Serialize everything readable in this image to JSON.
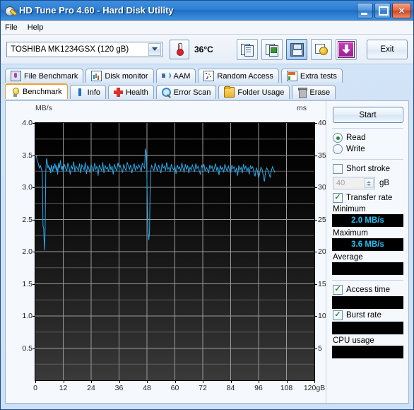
{
  "window": {
    "title": "HD Tune Pro 4.60 - Hard Disk Utility",
    "icon": "hard-disk-icon",
    "minimize_label": "",
    "maximize_label": "",
    "close_label": "✕"
  },
  "menu": {
    "items": [
      "File",
      "Help"
    ]
  },
  "toolbar": {
    "drive_selected": "TOSHIBA MK1234GSX (120 gB)",
    "temperature": "36°C",
    "thermometer_icon": "thermometer-icon",
    "buttons": [
      {
        "name": "copy-text-button",
        "icon": "copy-document-icon"
      },
      {
        "name": "copy-image-button",
        "icon": "copy-image-icon"
      },
      {
        "name": "save-button",
        "icon": "floppy-save-icon"
      },
      {
        "name": "certificate-button",
        "icon": "certificate-seal-icon"
      },
      {
        "name": "download-button",
        "icon": "download-arrow-icon"
      }
    ],
    "exit_label": "Exit"
  },
  "tabs": {
    "row1": [
      {
        "label": "File Benchmark",
        "icon": "file-benchmark-icon",
        "active": false
      },
      {
        "label": "Disk monitor",
        "icon": "disk-monitor-icon",
        "active": false
      },
      {
        "label": "AAM",
        "icon": "speaker-icon",
        "active": false
      },
      {
        "label": "Random Access",
        "icon": "random-access-icon",
        "active": false
      },
      {
        "label": "Extra tests",
        "icon": "extra-tests-icon",
        "active": false
      }
    ],
    "row2": [
      {
        "label": "Benchmark",
        "icon": "lightbulb-icon",
        "active": true
      },
      {
        "label": "Info",
        "icon": "info-icon",
        "active": false
      },
      {
        "label": "Health",
        "icon": "health-cross-icon",
        "active": false
      },
      {
        "label": "Error Scan",
        "icon": "magnifier-icon",
        "active": false
      },
      {
        "label": "Folder Usage",
        "icon": "folder-icon",
        "active": false
      },
      {
        "label": "Erase",
        "icon": "trash-icon",
        "active": false
      }
    ]
  },
  "panel": {
    "start_label": "Start",
    "mode_options": [
      {
        "label": "Read",
        "selected": true
      },
      {
        "label": "Write",
        "selected": false
      }
    ],
    "short_stroke": {
      "label": "Short stroke",
      "checked": false,
      "value": "40",
      "unit": "gB"
    },
    "transfer_rate": {
      "label": "Transfer rate",
      "checked": true
    },
    "readouts": [
      {
        "label": "Minimum",
        "value": "2.0 MB/s"
      },
      {
        "label": "Maximum",
        "value": "3.6 MB/s"
      },
      {
        "label": "Average",
        "value": ""
      }
    ],
    "access_time": {
      "label": "Access time",
      "checked": true,
      "value": ""
    },
    "burst_rate": {
      "label": "Burst rate",
      "checked": true,
      "value": ""
    },
    "cpu_usage": {
      "label": "CPU usage",
      "value": ""
    },
    "accent_value_color": "#23c0f5",
    "value_bg_color": "#000000"
  },
  "chart_data": {
    "type": "line",
    "title": "",
    "xlabel": "",
    "ylabel": "MB/s",
    "y2label": "ms",
    "xlim": [
      0,
      120
    ],
    "ylim": [
      0,
      4.0
    ],
    "y2lim": [
      0,
      40
    ],
    "grid": true,
    "xticks": [
      0,
      12,
      24,
      36,
      48,
      60,
      72,
      84,
      96,
      108,
      120
    ],
    "xticklabels": [
      "0",
      "12",
      "24",
      "36",
      "48",
      "60",
      "72",
      "84",
      "96",
      "108",
      "120gB"
    ],
    "yticks": [
      0.5,
      1.0,
      1.5,
      2.0,
      2.5,
      3.0,
      3.5,
      4.0
    ],
    "yticklabels": [
      "0.5",
      "1.0",
      "1.5",
      "2.0",
      "2.5",
      "3.0",
      "3.5",
      "4.0"
    ],
    "y2ticks": [
      5,
      10,
      15,
      20,
      25,
      30,
      35,
      40
    ],
    "y2ticklabels": [
      "5",
      "10",
      "15",
      "20",
      "25",
      "30",
      "35",
      "40"
    ],
    "series": [
      {
        "name": "Transfer rate",
        "color": "#2aa9e8",
        "x": [
          0.3,
          0.8,
          1.2,
          1.5,
          1.8,
          2.1,
          2.4,
          2.7,
          3.0,
          3.3,
          3.6,
          3.9,
          4.2,
          4.5,
          4.8,
          5.1,
          5.4,
          5.7,
          6.0,
          6.3,
          6.6,
          6.9,
          7.2,
          7.5,
          7.8,
          8.1,
          8.4,
          8.7,
          9.0,
          9.3,
          9.6,
          10.0,
          10.4,
          10.8,
          11.2,
          11.6,
          12.0,
          12.5,
          13.0,
          13.5,
          14.0,
          14.5,
          15.0,
          15.5,
          16.0,
          16.5,
          17.0,
          17.5,
          18.0,
          18.5,
          19.0,
          19.5,
          20.0,
          20.5,
          21.0,
          21.5,
          22.0,
          22.5,
          23.0,
          23.5,
          24.0,
          24.5,
          25.0,
          25.5,
          26.0,
          26.5,
          27.0,
          27.5,
          28.0,
          28.5,
          29.0,
          29.5,
          30.0,
          30.5,
          31.0,
          31.5,
          32.0,
          32.5,
          33.0,
          33.5,
          34.0,
          34.5,
          35.0,
          35.5,
          36.0,
          36.5,
          37.0,
          37.5,
          38.0,
          38.5,
          39.0,
          39.5,
          40.0,
          40.5,
          41.0,
          41.5,
          42.0,
          42.5,
          43.0,
          43.5,
          44.0,
          44.5,
          45.0,
          45.5,
          46.0,
          46.5,
          47.0,
          47.3,
          47.6,
          47.9,
          48.2,
          48.5,
          48.8,
          49.1,
          49.4,
          49.7,
          50.0,
          50.5,
          51.0,
          51.5,
          52.0,
          52.5,
          53.0,
          53.5,
          54.0,
          54.5,
          55.0,
          55.5,
          56.0,
          56.5,
          57.0,
          57.5,
          58.0,
          58.5,
          59.0,
          59.5,
          60.0,
          60.5,
          61.0,
          61.5,
          62.0,
          62.5,
          63.0,
          63.5,
          64.0,
          64.5,
          65.0,
          65.5,
          66.0,
          66.5,
          67.0,
          67.5,
          68.0,
          68.5,
          69.0,
          69.5,
          70.0,
          70.5,
          71.0,
          71.5,
          72.0,
          72.5,
          73.0,
          73.5,
          74.0,
          74.5,
          75.0,
          75.5,
          76.0,
          76.5,
          77.0,
          77.5,
          78.0,
          78.5,
          79.0,
          79.5,
          80.0,
          80.5,
          81.0,
          81.5,
          82.0,
          82.5,
          83.0,
          83.5,
          84.0,
          84.5,
          85.0,
          85.5,
          86.0,
          86.5,
          87.0,
          87.5,
          88.0,
          88.5,
          89.0,
          89.5,
          90.0,
          90.5,
          91.0,
          91.5,
          92.0,
          92.5,
          93.0,
          93.5,
          94.0,
          94.5,
          95.0,
          95.5,
          96.0,
          96.5,
          97.0,
          97.5,
          98.0,
          98.5,
          99.0,
          99.5,
          100.0,
          100.5,
          101.0,
          101.5,
          102.0,
          102.5,
          103.0
        ],
        "y": [
          3.5,
          3.42,
          3.38,
          3.33,
          3.3,
          3.34,
          3.31,
          3.28,
          3.22,
          2.4,
          2.36,
          2.02,
          2.3,
          3.25,
          3.45,
          3.4,
          3.3,
          3.34,
          3.27,
          3.31,
          3.22,
          3.35,
          3.3,
          3.24,
          3.33,
          3.29,
          3.37,
          3.32,
          3.26,
          3.34,
          3.2,
          3.38,
          3.3,
          3.42,
          3.27,
          3.33,
          3.22,
          3.36,
          3.3,
          3.25,
          3.38,
          3.31,
          3.2,
          3.34,
          3.28,
          3.4,
          3.24,
          3.33,
          3.3,
          3.26,
          3.37,
          3.22,
          3.35,
          3.31,
          3.27,
          3.39,
          3.21,
          3.34,
          3.29,
          3.23,
          3.36,
          3.3,
          3.25,
          3.38,
          3.28,
          3.33,
          3.18,
          3.35,
          3.3,
          3.26,
          3.39,
          3.22,
          3.34,
          3.29,
          3.31,
          3.24,
          3.37,
          3.27,
          3.33,
          3.2,
          3.36,
          3.3,
          3.25,
          3.38,
          3.31,
          3.34,
          3.28,
          3.23,
          3.36,
          3.3,
          3.26,
          3.39,
          3.33,
          3.28,
          3.35,
          3.22,
          3.3,
          3.37,
          3.26,
          3.33,
          3.29,
          3.35,
          3.31,
          3.24,
          3.38,
          3.33,
          3.29,
          3.6,
          3.55,
          3.3,
          2.7,
          2.34,
          2.18,
          2.3,
          3.05,
          3.28,
          3.34,
          3.3,
          3.26,
          3.38,
          3.31,
          3.25,
          3.35,
          3.29,
          3.22,
          3.37,
          3.3,
          3.33,
          3.26,
          3.39,
          3.28,
          3.31,
          3.24,
          3.36,
          3.3,
          3.27,
          3.33,
          3.21,
          3.35,
          3.29,
          3.32,
          3.25,
          3.38,
          3.3,
          3.23,
          3.36,
          3.28,
          3.34,
          3.22,
          3.31,
          3.27,
          3.35,
          3.3,
          3.24,
          3.37,
          3.29,
          3.33,
          3.26,
          3.2,
          3.34,
          3.3,
          3.36,
          3.25,
          3.31,
          3.28,
          3.22,
          3.35,
          3.29,
          3.33,
          3.24,
          3.3,
          3.37,
          3.26,
          3.32,
          3.19,
          3.34,
          3.28,
          3.31,
          3.23,
          3.36,
          3.3,
          3.25,
          3.33,
          3.27,
          3.21,
          3.35,
          3.29,
          3.32,
          3.24,
          3.3,
          3.18,
          3.34,
          3.27,
          3.31,
          3.22,
          3.36,
          3.28,
          3.33,
          3.25,
          3.3,
          3.2,
          3.34,
          3.29,
          3.32,
          3.23,
          3.17,
          3.3,
          3.26,
          3.14,
          3.22,
          3.31,
          3.28,
          3.19,
          3.09,
          3.24,
          3.3,
          3.27,
          3.21,
          3.15,
          3.26,
          3.32,
          3.28,
          3.23
        ]
      }
    ]
  }
}
